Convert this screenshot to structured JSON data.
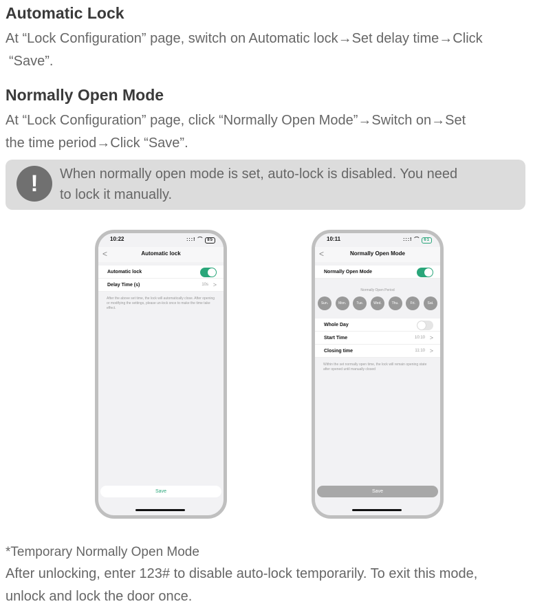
{
  "sections": [
    {
      "heading": "Automatic Lock",
      "lines": [
        "At “Lock Configuration” page, switch on Automatic lock→Set delay time→Click",
        "“Save”."
      ]
    },
    {
      "heading": "Normally Open Mode",
      "lines": [
        "At “Lock Configuration” page, click “Normally Open Mode”→Switch on→Set",
        "the time period→Click “Save”."
      ]
    }
  ],
  "note": {
    "icon": "exclamation-icon",
    "lines": [
      "When normally open mode is set, auto-lock is disabled. You need",
      "to lock it manually."
    ]
  },
  "phone1": {
    "time": "10:22",
    "signal": ":::!",
    "wifi": "⌒",
    "battery": "85",
    "title": "Automatic lock",
    "back": "<",
    "rows": [
      {
        "label": "Automatic lock",
        "toggle": true
      },
      {
        "label": "Delay Time (s)",
        "value": "10s",
        "chevron": ">"
      }
    ],
    "hint": "After the above set time, the lock will automatically close. After opening or modifying the settings, please un-lock once to make the time take effect.",
    "save": "Save",
    "accent": "#2aa67a"
  },
  "phone2": {
    "time": "10:11",
    "signal": ":::!",
    "wifi": "⌒",
    "battery": "61",
    "title": "Normally Open Mode",
    "back": "<",
    "mode_label": "Normally Open Mode",
    "period_title": "Normally Open Period",
    "days": [
      "Sun.",
      "Mon.",
      "Tue.",
      "Wed.",
      "Thu.",
      "Fri.",
      "Sat."
    ],
    "rows": [
      {
        "label": "Whole Day",
        "toggle": false
      },
      {
        "label": "Start Time",
        "value": "10:10",
        "chevron": ">"
      },
      {
        "label": "Closing time",
        "value": "11:10",
        "chevron": ">"
      }
    ],
    "hint": "Within the set normally open time, the lock will remain opening state after opened until manually closed",
    "save": "Save"
  },
  "footer": {
    "title": "*Temporary Normally Open Mode",
    "lines": [
      "After unlocking, enter 123# to disable auto-lock temporarily. To exit this mode,",
      "unlock and lock the door once."
    ]
  }
}
